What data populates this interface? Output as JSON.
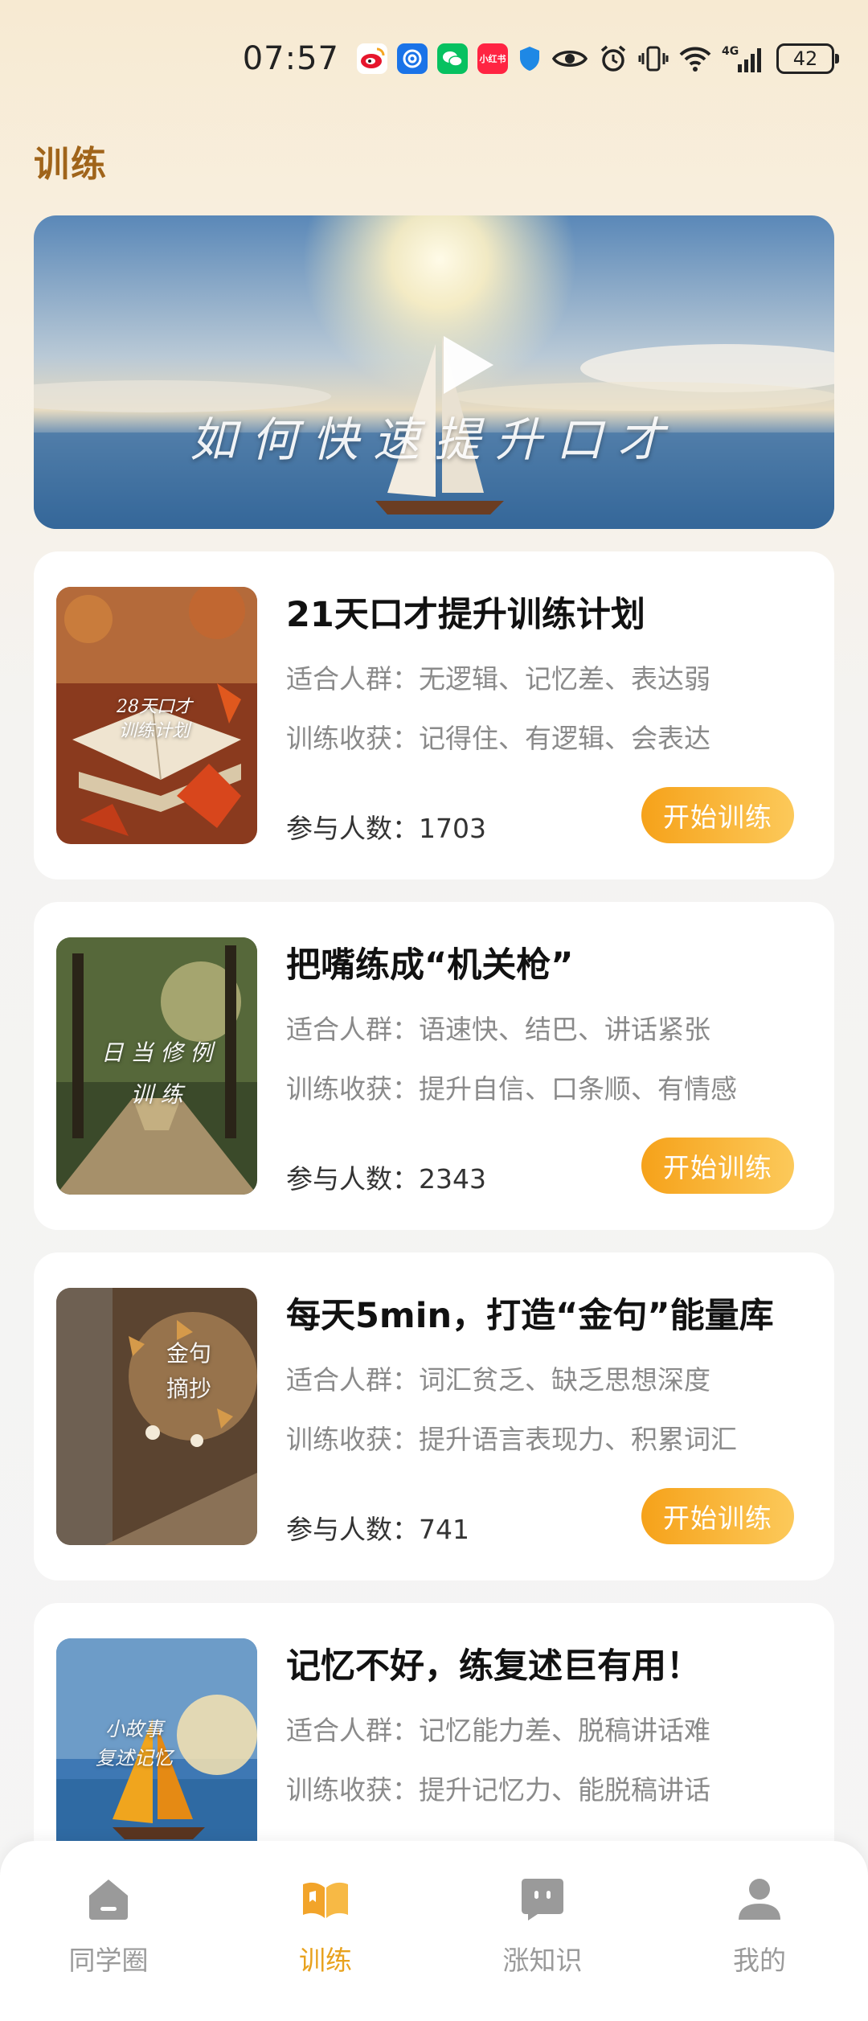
{
  "status_bar": {
    "time": "07:57",
    "notification_icons": [
      "weibo-icon",
      "browser-icon",
      "wechat-icon",
      "xiaohongshu-icon",
      "shield-icon"
    ],
    "xiaohongshu_text": "小红书",
    "network": "4G",
    "battery": "42"
  },
  "page": {
    "title": "训练"
  },
  "banner": {
    "caption": "如何快速提升口才"
  },
  "courses": [
    {
      "title": "21天口才提升训练计划",
      "audience": "适合人群：无逻辑、记忆差、表达弱",
      "gains": "训练收获：记得住、有逻辑、会表达",
      "participants_label": "参与人数：",
      "participants": "1703",
      "button": "开始训练",
      "thumb_text": "28天口才\n训练计划"
    },
    {
      "title": "把嘴练成“机关枪”",
      "audience": "适合人群：语速快、结巴、讲话紧张",
      "gains": "训练收获：提升自信、口条顺、有情感",
      "participants_label": "参与人数：",
      "participants": "2343",
      "button": "开始训练",
      "thumb_text": "日 当 修 例\n训 练"
    },
    {
      "title": "每天5min，打造“金句”能量库",
      "audience": "适合人群：词汇贫乏、缺乏思想深度",
      "gains": "训练收获：提升语言表现力、积累词汇",
      "participants_label": "参与人数：",
      "participants": "741",
      "button": "开始训练",
      "thumb_text": "金句\n摘抄"
    },
    {
      "title": "记忆不好，练复述巨有用！",
      "audience": "适合人群：记忆能力差、脱稿讲话难",
      "gains": "训练收获：提升记忆力、能脱稿讲话",
      "thumb_text": "小故事\n复述记忆"
    }
  ],
  "nav": {
    "items": [
      {
        "label": "同学圈",
        "icon": "home-icon",
        "active": false
      },
      {
        "label": "训练",
        "icon": "book-icon",
        "active": true
      },
      {
        "label": "涨知识",
        "icon": "chat-icon",
        "active": false
      },
      {
        "label": "我的",
        "icon": "profile-icon",
        "active": false
      }
    ],
    "active_color": "#e8a21e",
    "inactive_color": "#9a9a9a"
  },
  "colors": {
    "title_accent": "#a0641a",
    "button_gradient": [
      "#f6a21a",
      "#fcc95a"
    ]
  }
}
